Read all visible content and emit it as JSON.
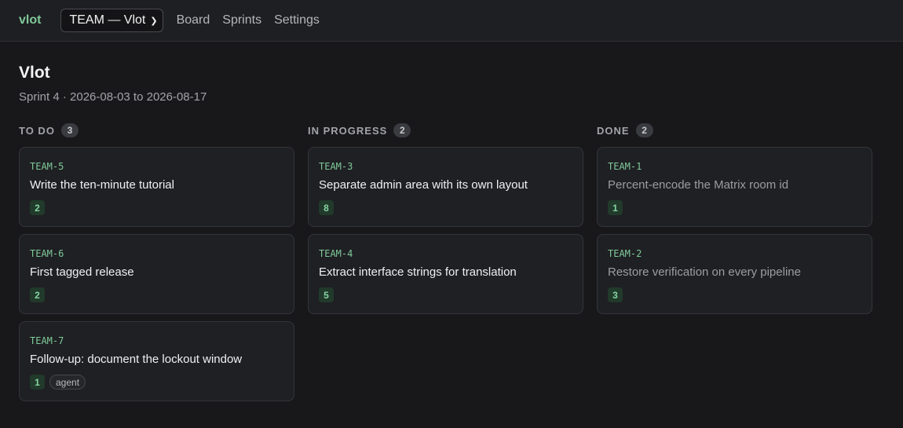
{
  "app": {
    "brand": "vlot"
  },
  "header": {
    "team_select": "TEAM — Vlot",
    "nav": [
      "Board",
      "Sprints",
      "Settings"
    ]
  },
  "page": {
    "title": "Vlot",
    "sprint_info": "Sprint 4 · 2026-08-03 to 2026-08-17"
  },
  "columns": [
    {
      "title": "TO DO",
      "count": "3",
      "cards": [
        {
          "key": "TEAM-5",
          "title": "Write the ten-minute tutorial",
          "points": "2"
        },
        {
          "key": "TEAM-6",
          "title": "First tagged release",
          "points": "2"
        },
        {
          "key": "TEAM-7",
          "title": "Follow-up: document the lockout window",
          "points": "1",
          "tag": "agent"
        }
      ]
    },
    {
      "title": "IN PROGRESS",
      "count": "2",
      "cards": [
        {
          "key": "TEAM-3",
          "title": "Separate admin area with its own layout",
          "points": "8"
        },
        {
          "key": "TEAM-4",
          "title": "Extract interface strings for translation",
          "points": "5"
        }
      ]
    },
    {
      "title": "DONE",
      "count": "2",
      "cards": [
        {
          "key": "TEAM-1",
          "title": "Percent-encode the Matrix room id",
          "points": "1"
        },
        {
          "key": "TEAM-2",
          "title": "Restore verification on every pipeline",
          "points": "3"
        }
      ]
    }
  ]
}
